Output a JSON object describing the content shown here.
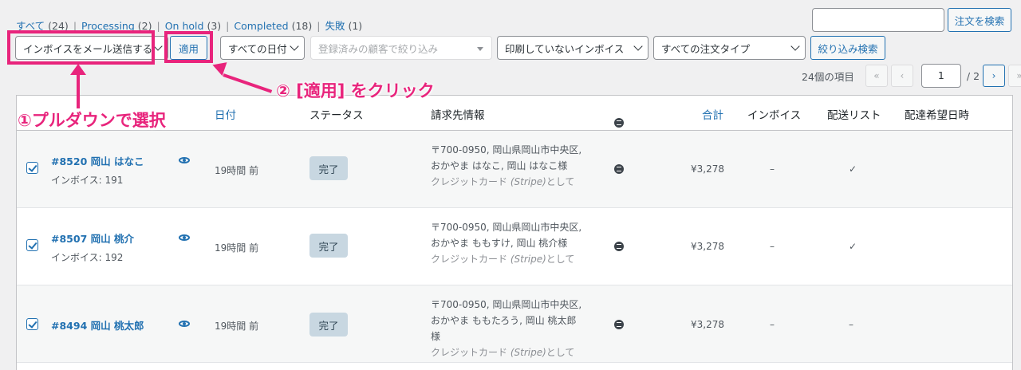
{
  "status_filters": [
    {
      "label": "すべて",
      "count": "(24)"
    },
    {
      "label": "Processing",
      "count": "(2)"
    },
    {
      "label": "On hold",
      "count": "(3)"
    },
    {
      "label": "Completed",
      "count": "(18)"
    },
    {
      "label": "失敗",
      "count": "(1)"
    }
  ],
  "search": {
    "value": "",
    "button_label": "注文を検索"
  },
  "toolbar": {
    "bulk_action": "インボイスをメール送信する",
    "apply_label": "適用",
    "date_filter": "すべての日付",
    "customer_placeholder": "登録済みの顧客で絞り込み",
    "print_filter": "印刷していないインボイス",
    "order_type_filter": "すべての注文タイプ",
    "filter_label": "絞り込み検索"
  },
  "pagination": {
    "items_text": "24個の項目",
    "first": "«",
    "prev": "‹",
    "current_page": "1",
    "total_pages": "/ 2",
    "next": "›",
    "last": "»"
  },
  "columns": {
    "date": "日付",
    "status": "ステータス",
    "billing": "請求先情報",
    "total": "合計",
    "invoice": "インボイス",
    "shipping_list": "配送リスト",
    "delivery_time": "配達希望日時"
  },
  "orders": [
    {
      "order": "#8520 岡山 はなこ",
      "invoice": "インボイス: 191",
      "date": "19時間 前",
      "status": "完了",
      "address": "〒700-0950, 岡山県岡山市中央区, おかやま はなこ, 岡山 はなこ様",
      "payment": "クレジットカード",
      "payment_method": "(Stripe)",
      "payment_suffix": "として",
      "total": "¥3,278",
      "invoice_col": "–",
      "shipping_list": "✓"
    },
    {
      "order": "#8507 岡山 桃介",
      "invoice": "インボイス: 192",
      "date": "19時間 前",
      "status": "完了",
      "address": "〒700-0950, 岡山県岡山市中央区, おかやま ももすけ, 岡山 桃介様",
      "payment": "クレジットカード",
      "payment_method": "(Stripe)",
      "payment_suffix": "として",
      "total": "¥3,278",
      "invoice_col": "–",
      "shipping_list": "✓"
    },
    {
      "order": "#8494 岡山 桃太郎",
      "invoice": "",
      "date": "19時間 前",
      "status": "完了",
      "address": "〒700-0950, 岡山県岡山市中央区, おかやま ももたろう, 岡山 桃太郎様",
      "payment": "クレジットカード",
      "payment_method": "(Stripe)",
      "payment_suffix": "として",
      "total": "¥3,278",
      "invoice_col": "–",
      "shipping_list": "–"
    }
  ],
  "annotations": {
    "step1": "①プルダウンで選択",
    "step2": "② [適用] をクリック"
  },
  "colors": {
    "highlight": "#e8247c",
    "link": "#2271b1",
    "status_complete_bg": "#c8d7e1"
  }
}
